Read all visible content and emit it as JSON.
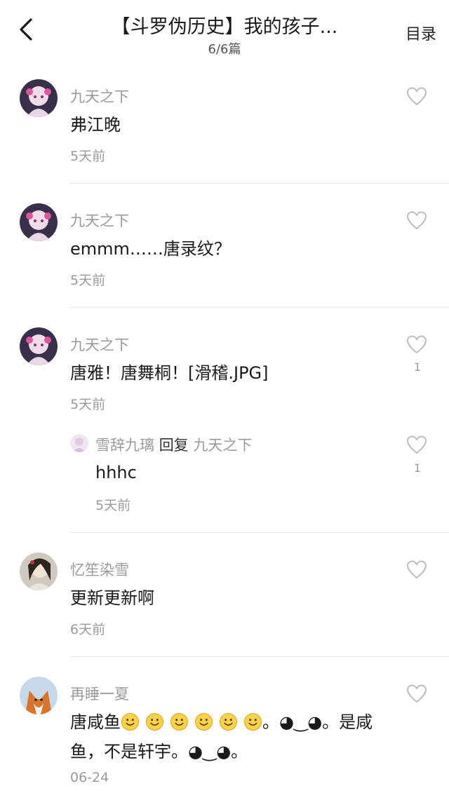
{
  "header": {
    "title": "【斗罗伪历史】我的孩子...",
    "subtitle": "6/6篇",
    "toc_label": "目录"
  },
  "comments": [
    {
      "user": "九天之下",
      "text": "弗江晚",
      "time": "5天前",
      "likes": ""
    },
    {
      "user": "九天之下",
      "text": "emmm……唐录纹？",
      "time": "5天前",
      "likes": ""
    },
    {
      "user": "九天之下",
      "text": "唐雅！唐舞桐！[滑稽.JPG]",
      "time": "5天前",
      "likes": "1",
      "reply": {
        "user": "雪辞九璃",
        "reply_word": "回复",
        "reply_to": "九天之下",
        "text": "hhhc",
        "time": "5天前",
        "likes": "1"
      }
    },
    {
      "user": "忆笙染雪",
      "text": "更新更新啊",
      "time": "6天前",
      "likes": ""
    },
    {
      "user": "再睡一夏",
      "text_prefix": "唐咸鱼",
      "emoji_count": 6,
      "kaomoji_1": "。◕‿◕。",
      "text_mid": "是咸",
      "text_line2": "鱼，不是轩宇",
      "kaomoji_2": "。◕‿◕。",
      "time": "06-24",
      "likes": ""
    }
  ],
  "icons": {
    "back": "chevron-left-icon",
    "like": "heart-outline-icon",
    "emoji": "smiley-emoji-icon"
  },
  "colors": {
    "secondary_text": "#9a9a9a",
    "primary_text": "#1a1a1a",
    "divider": "#e6e6e6",
    "emoji": "#f5d24a"
  }
}
